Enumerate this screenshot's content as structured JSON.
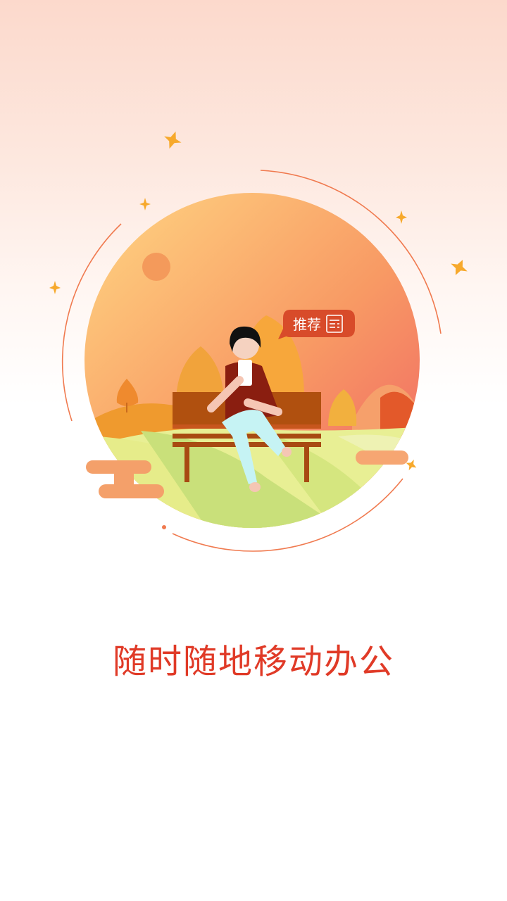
{
  "splash": {
    "badge_label": "推荐",
    "tagline": "随时随地移动办公"
  },
  "icons": {
    "badge": "document-list-icon",
    "sparkle": "sparkle-icon"
  },
  "colors": {
    "accent_red": "#e03a27",
    "badge_red": "#d84b2a",
    "orange": "#f39b3a",
    "peach": "#f5a97a"
  }
}
